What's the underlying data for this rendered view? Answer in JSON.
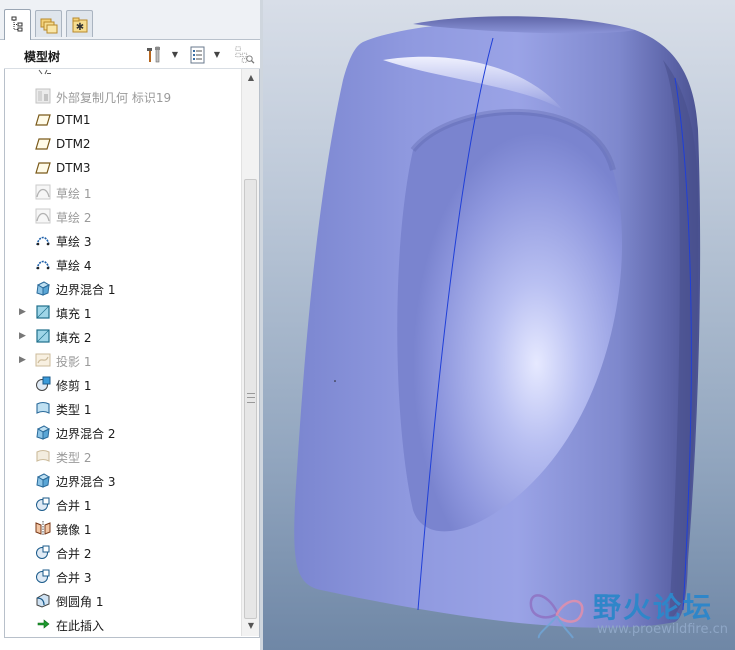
{
  "panel_tabs": [
    {
      "name": "model-tree-tab",
      "icon": "tree-structure-icon",
      "active": true
    },
    {
      "name": "folder-browser-tab",
      "icon": "folders-icon",
      "active": false
    },
    {
      "name": "favorites-tab",
      "icon": "favorites-icon",
      "active": false
    }
  ],
  "model_tree": {
    "title": "模型树",
    "tools": [
      {
        "name": "settings",
        "icon": "tools-icon"
      },
      {
        "name": "show",
        "icon": "list-icon"
      },
      {
        "name": "columns",
        "icon": "columns-icon"
      }
    ],
    "items": [
      {
        "label": "外部复制几何 标识19",
        "icon": "external-copy-geometry-icon",
        "dim": true,
        "expandable": false
      },
      {
        "label": "DTM1",
        "icon": "datum-plane-icon",
        "dim": false,
        "expandable": false
      },
      {
        "label": "DTM2",
        "icon": "datum-plane-icon",
        "dim": false,
        "expandable": false
      },
      {
        "label": "DTM3",
        "icon": "datum-plane-icon",
        "dim": false,
        "expandable": false
      },
      {
        "label": "草绘 1",
        "icon": "sketch-icon",
        "dim": true,
        "expandable": false
      },
      {
        "label": "草绘 2",
        "icon": "sketch-icon",
        "dim": true,
        "expandable": false
      },
      {
        "label": "草绘 3",
        "icon": "sketch-icon",
        "dim": false,
        "expandable": false
      },
      {
        "label": "草绘 4",
        "icon": "sketch-icon",
        "dim": false,
        "expandable": false
      },
      {
        "label": "边界混合 1",
        "icon": "boundary-blend-icon",
        "dim": false,
        "expandable": false
      },
      {
        "label": "填充 1",
        "icon": "fill-icon",
        "dim": false,
        "expandable": true
      },
      {
        "label": "填充 2",
        "icon": "fill-icon",
        "dim": false,
        "expandable": true
      },
      {
        "label": "投影 1",
        "icon": "projection-icon",
        "dim": true,
        "expandable": true
      },
      {
        "label": "修剪 1",
        "icon": "trim-icon",
        "dim": false,
        "expandable": false
      },
      {
        "label": "类型 1",
        "icon": "surface-type-icon",
        "dim": false,
        "expandable": false
      },
      {
        "label": "边界混合 2",
        "icon": "boundary-blend-icon",
        "dim": false,
        "expandable": false
      },
      {
        "label": "类型 2",
        "icon": "surface-type-icon",
        "dim": true,
        "expandable": false
      },
      {
        "label": "边界混合 3",
        "icon": "boundary-blend-icon",
        "dim": false,
        "expandable": false
      },
      {
        "label": "合并 1",
        "icon": "merge-icon",
        "dim": false,
        "expandable": false
      },
      {
        "label": "镜像 1",
        "icon": "mirror-icon",
        "dim": false,
        "expandable": false
      },
      {
        "label": "合并 2",
        "icon": "merge-icon",
        "dim": false,
        "expandable": false
      },
      {
        "label": "合并 3",
        "icon": "merge-icon",
        "dim": false,
        "expandable": false
      },
      {
        "label": "倒圆角 1",
        "icon": "round-icon",
        "dim": false,
        "expandable": false
      },
      {
        "label": "在此插入",
        "icon": "insert-here-arrow-icon",
        "dim": false,
        "expandable": false
      }
    ]
  },
  "watermark": {
    "title": "野火论坛",
    "url": "www.proewildfire.cn"
  },
  "colors": {
    "model_surface": "#8c95dc",
    "viewport_top": "#d8dee8",
    "viewport_bottom": "#6f87a6",
    "edge_line": "#1f3fd8",
    "watermark_text": "#2f86c9"
  }
}
